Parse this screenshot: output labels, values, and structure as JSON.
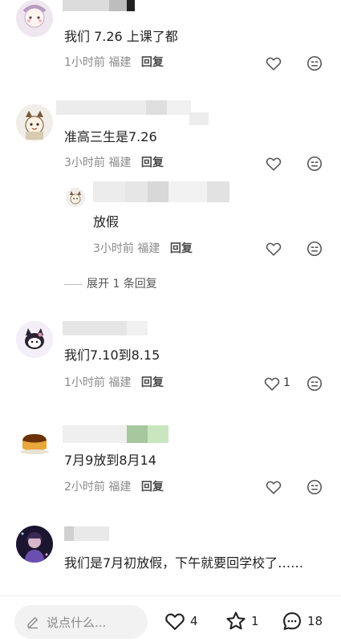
{
  "comments": [
    {
      "text": "我们 7.26 上课了都",
      "time": "1小时前",
      "location": "福建",
      "reply_label": "回复",
      "likes": ""
    },
    {
      "text": "准高三生是7.26",
      "time": "3小时前",
      "location": "福建",
      "reply_label": "回复",
      "likes": "",
      "replies": [
        {
          "text": "放假",
          "time": "3小时前",
          "location": "福建",
          "reply_label": "回复"
        }
      ],
      "expand_label": "展开 1 条回复"
    },
    {
      "text": "我们7.10到8.15",
      "time": "1小时前",
      "location": "福建",
      "reply_label": "回复",
      "likes": "1"
    },
    {
      "text": "7月9放到8月14",
      "time": "2小时前",
      "location": "福建",
      "reply_label": "回复",
      "likes": ""
    },
    {
      "text": "我们是7月初放假，下午就要回学校了……",
      "time": "",
      "location": "",
      "reply_label": "",
      "likes": ""
    }
  ],
  "bottom_bar": {
    "input_placeholder": "说点什么...",
    "like_count": "4",
    "favorite_count": "1",
    "comment_count": "18"
  },
  "icons": {
    "like": "heart-outline-icon",
    "dislike": "meh-face-icon",
    "pen": "pen-icon",
    "favorite": "star-outline-icon",
    "comment": "chat-bubble-icon"
  }
}
